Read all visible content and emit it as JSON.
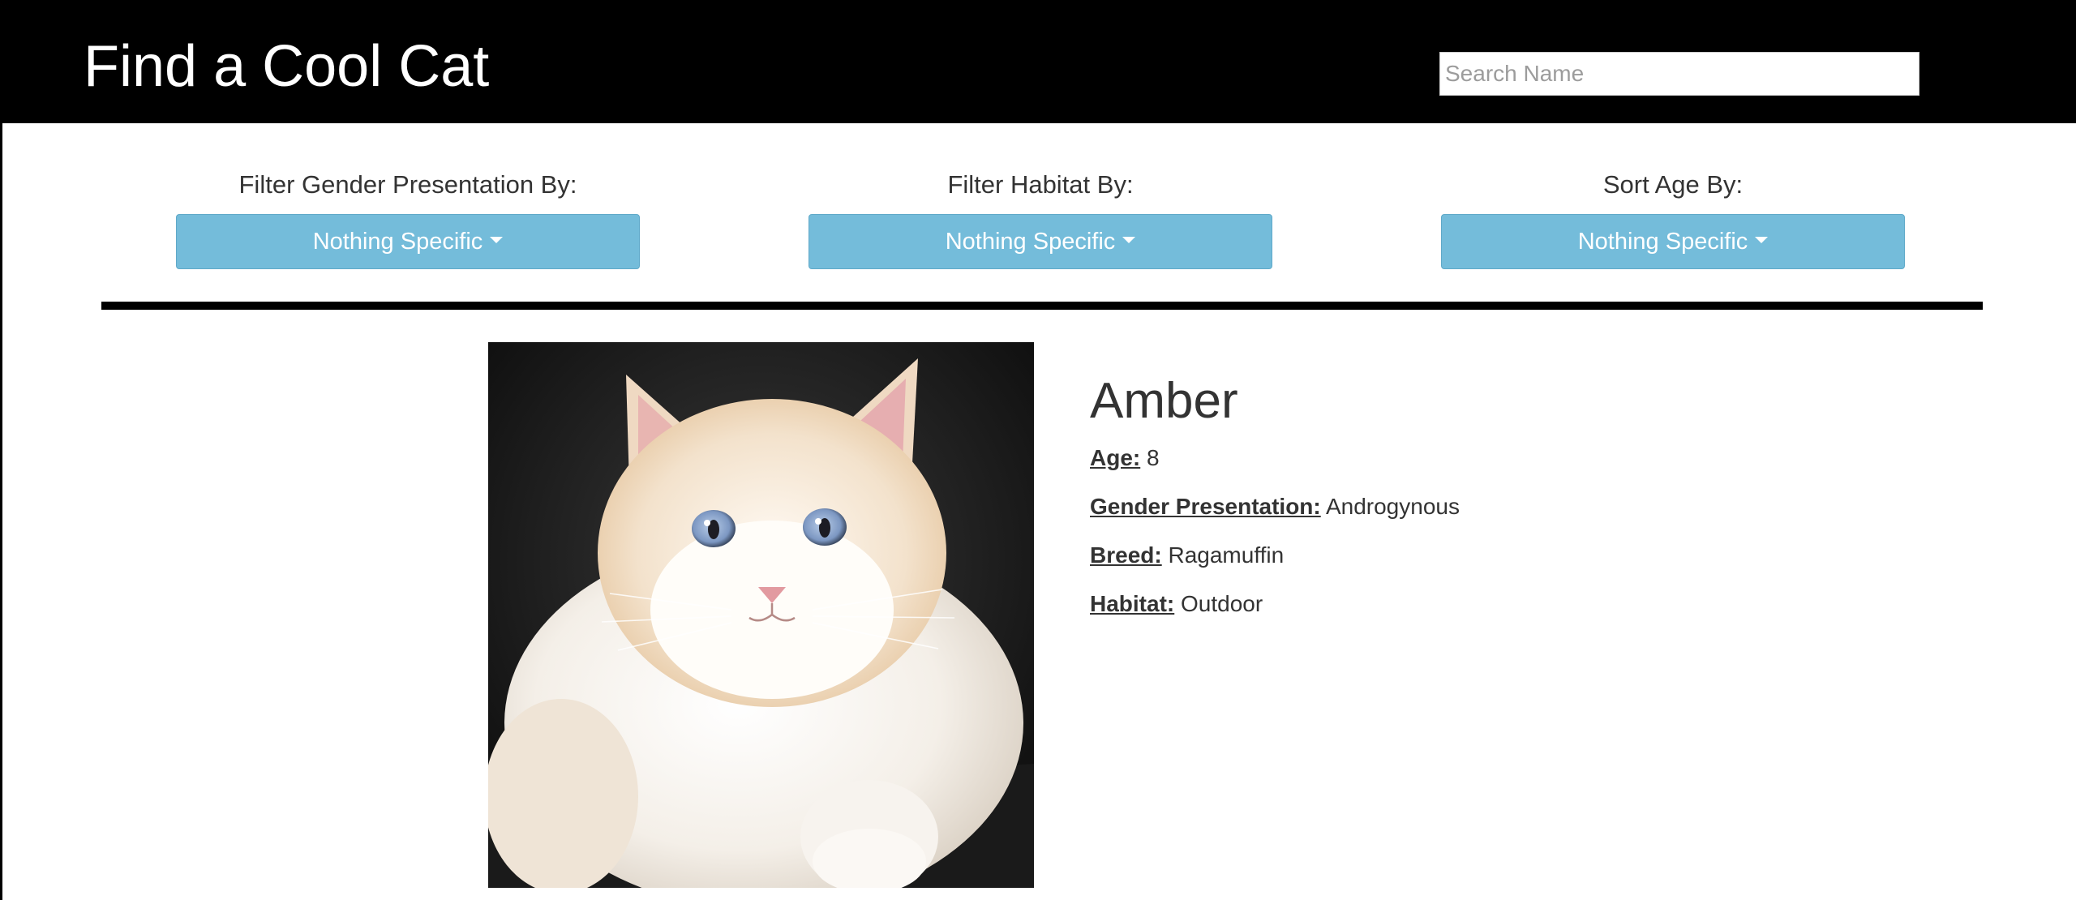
{
  "header": {
    "title": "Find a Cool Cat",
    "search_placeholder": "Search Name"
  },
  "filters": [
    {
      "label": "Filter Gender Presentation By:",
      "value": "Nothing Specific"
    },
    {
      "label": "Filter Habitat By:",
      "value": "Nothing Specific"
    },
    {
      "label": "Sort Age By:",
      "value": "Nothing Specific"
    }
  ],
  "cat": {
    "name": "Amber",
    "photo": "white-fluffy-cat-photo",
    "fields": [
      {
        "label": "Age:",
        "value": "8"
      },
      {
        "label": "Gender Presentation:",
        "value": "Androgynous"
      },
      {
        "label": "Breed:",
        "value": "Ragamuffin"
      },
      {
        "label": "Habitat:",
        "value": "Outdoor"
      }
    ]
  },
  "colors": {
    "header_bg": "#000000",
    "dropdown_bg": "#74bcda",
    "text": "#333333"
  }
}
